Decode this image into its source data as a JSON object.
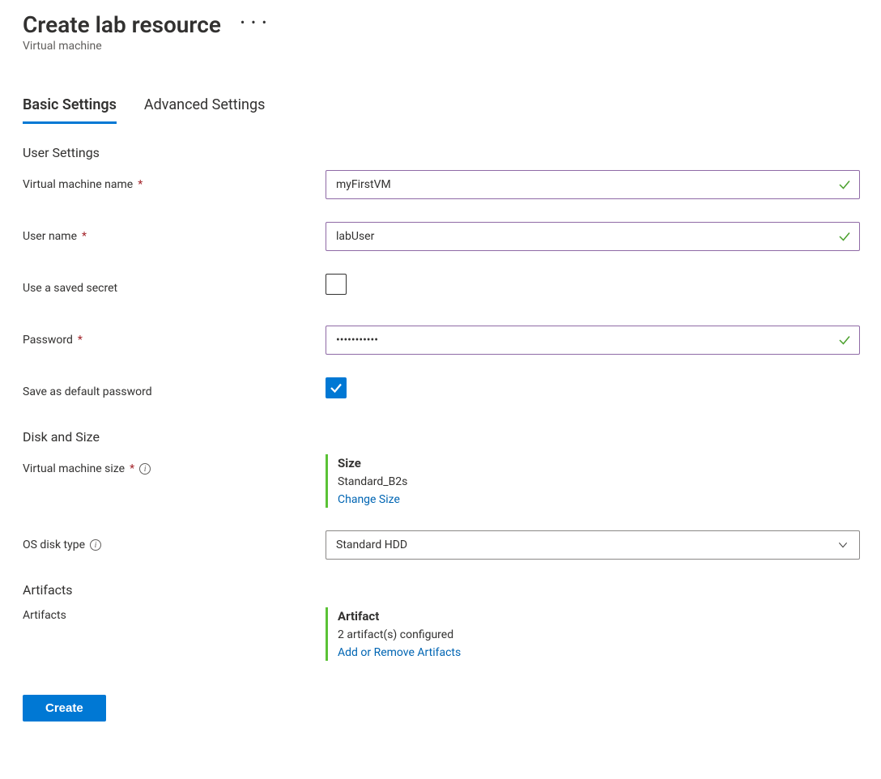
{
  "header": {
    "title": "Create lab resource",
    "subtitle": "Virtual machine"
  },
  "tabs": {
    "basic": "Basic Settings",
    "advanced": "Advanced Settings"
  },
  "sections": {
    "user_settings": "User Settings",
    "disk_and_size": "Disk and Size",
    "artifacts": "Artifacts"
  },
  "fields": {
    "vm_name": {
      "label": "Virtual machine name",
      "value": "myFirstVM"
    },
    "user_name": {
      "label": "User name",
      "value": "labUser"
    },
    "use_saved_secret": {
      "label": "Use a saved secret",
      "checked": false
    },
    "password": {
      "label": "Password",
      "value": "•••••••••••"
    },
    "save_default_password": {
      "label": "Save as default password",
      "checked": true
    },
    "vm_size": {
      "label": "Virtual machine size"
    },
    "os_disk_type": {
      "label": "OS disk type",
      "selected": "Standard HDD"
    },
    "artifacts": {
      "label": "Artifacts"
    }
  },
  "size_panel": {
    "title": "Size",
    "value": "Standard_B2s",
    "link": "Change Size"
  },
  "artifacts_panel": {
    "title": "Artifact",
    "value": "2 artifact(s) configured",
    "link": "Add or Remove Artifacts"
  },
  "buttons": {
    "create": "Create"
  }
}
